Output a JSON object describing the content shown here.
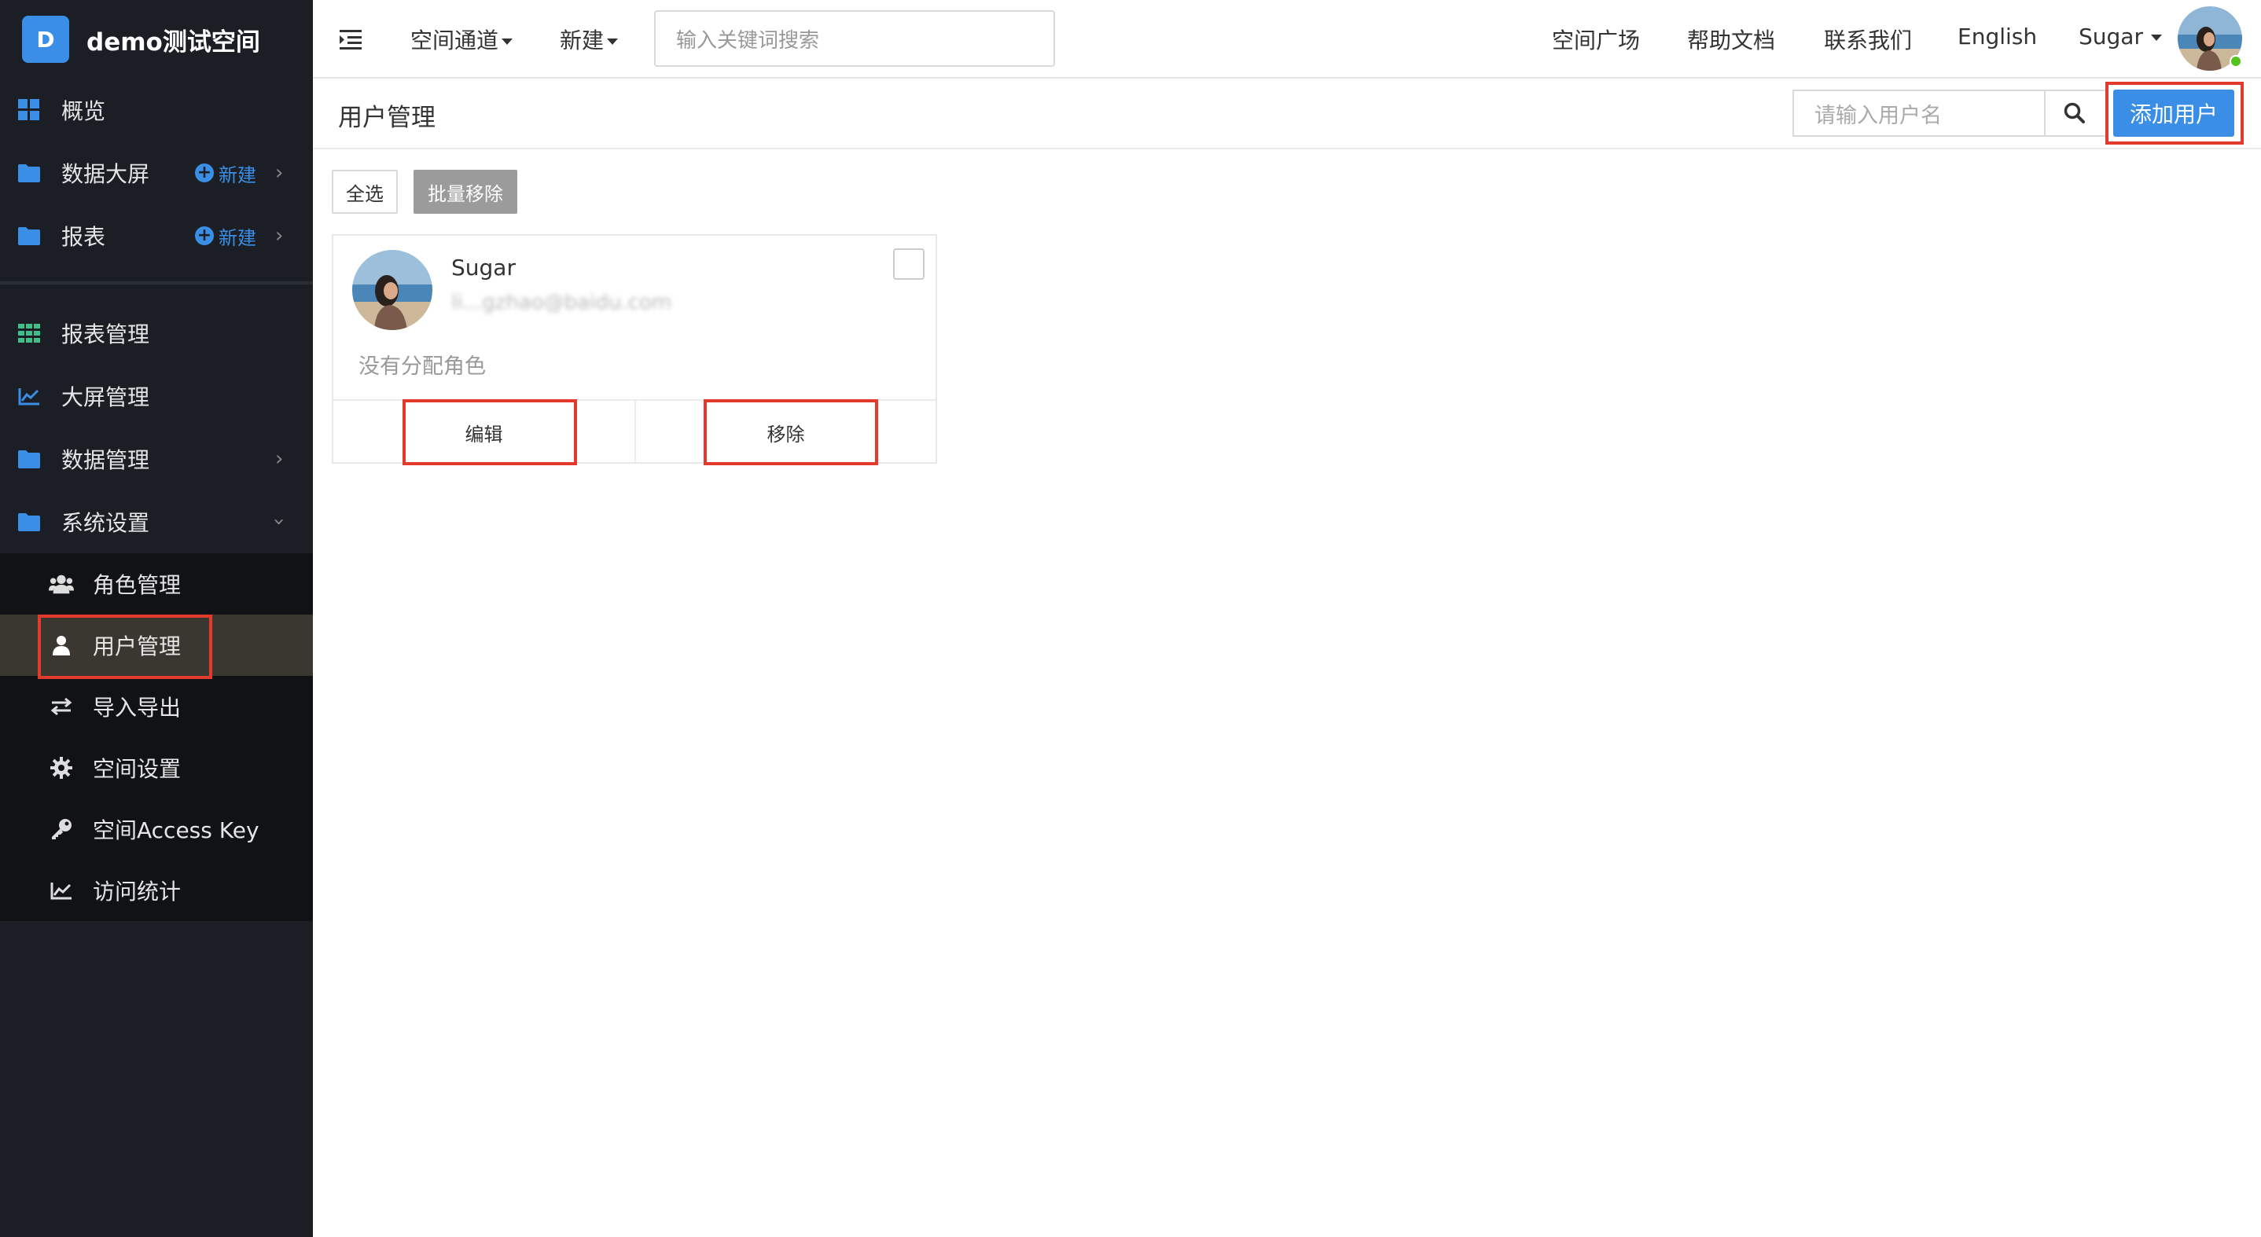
{
  "sidebar": {
    "brand_letter": "D",
    "brand_name": "demo测试空间",
    "top_items": [
      {
        "label": "概览",
        "icon": "dashboard-grid-icon"
      },
      {
        "label": "数据大屏",
        "icon": "folder-icon",
        "new_label": "新建"
      },
      {
        "label": "报表",
        "icon": "folder-icon",
        "new_label": "新建"
      }
    ],
    "manage_items": [
      {
        "label": "报表管理",
        "icon": "table-grid-icon"
      },
      {
        "label": "大屏管理",
        "icon": "line-chart-icon"
      },
      {
        "label": "数据管理",
        "icon": "folder-icon"
      },
      {
        "label": "系统设置",
        "icon": "folder-icon"
      }
    ],
    "settings_items": [
      {
        "label": "角色管理",
        "icon": "users-icon"
      },
      {
        "label": "用户管理",
        "icon": "user-icon"
      },
      {
        "label": "导入导出",
        "icon": "swap-arrows-icon"
      },
      {
        "label": "空间设置",
        "icon": "gear-icon"
      },
      {
        "label": "空间Access Key",
        "icon": "key-icon"
      },
      {
        "label": "访问统计",
        "icon": "area-chart-icon"
      }
    ],
    "active_item": "用户管理"
  },
  "topbar": {
    "space_channel": "空间通道",
    "new": "新建",
    "search_placeholder": "输入关键词搜索",
    "space_plaza": "空间广场",
    "help_docs": "帮助文档",
    "contact_us": "联系我们",
    "language": "English",
    "username": "Sugar"
  },
  "page": {
    "title": "用户管理",
    "user_search_placeholder": "请输入用户名",
    "add_user": "添加用户",
    "select_all": "全选",
    "batch_remove": "批量移除"
  },
  "users": [
    {
      "name": "Sugar",
      "email": "li...gzhao@baidu.com",
      "role": "没有分配角色",
      "edit_label": "编辑",
      "remove_label": "移除"
    }
  ],
  "colors": {
    "sidebar_bg": "#1b1e24",
    "accent": "#3a8ee6",
    "highlight": "#e23b2e",
    "online": "#52c41a"
  }
}
